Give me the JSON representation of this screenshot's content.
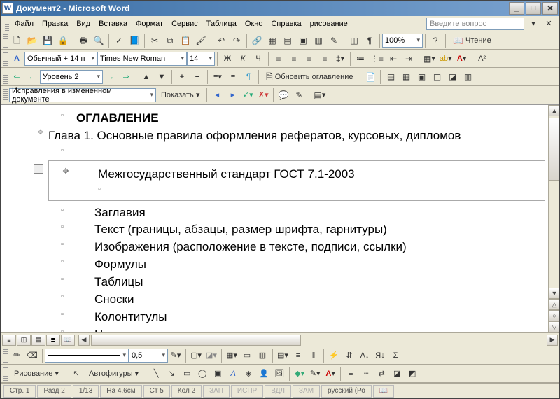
{
  "title": "Документ2 - Microsoft Word",
  "menu": [
    "Файл",
    "Правка",
    "Вид",
    "Вставка",
    "Формат",
    "Сервис",
    "Таблица",
    "Окно",
    "Справка",
    "рисование"
  ],
  "askPlaceholder": "Введите вопрос",
  "zoom": "100%",
  "readLabel": "Чтение",
  "style": "Обычный + 14 п",
  "font": "Times New Roman",
  "size": "14",
  "outlineLevel": "Уровень 2",
  "tocUpdate": "Обновить оглавление",
  "reviewMode": "Исправления в измененном документе",
  "showLabel": "Показать",
  "lineWeight": "0,5",
  "drawLabel": "Рисование",
  "autoshapes": "Автофигуры",
  "doc": {
    "toc_title": "ОГЛАВЛЕНИЕ",
    "chapter": "Глава 1. Основные правила оформления рефератов, курсовых, дипломов",
    "standard": "Межгосударственный стандарт ГОСТ 7.1-2003",
    "items": [
      "Заглавия",
      "Текст (границы, абзацы, размер шрифта, гарнитуры)",
      "Изображения (расположение в тексте, подписи, ссылки)",
      "Формулы",
      "Таблицы",
      "Сноски",
      "Колонтитулы",
      "Нумерация"
    ]
  },
  "status": {
    "page": "Стр. 1",
    "section": "Разд 2",
    "pages": "1/13",
    "at": "На 4,6см",
    "line": "Ст 5",
    "col": "Кол 2",
    "flags": [
      "ЗАП",
      "ИСПР",
      "ВДЛ",
      "ЗАМ"
    ],
    "lang": "русский (Ро"
  }
}
